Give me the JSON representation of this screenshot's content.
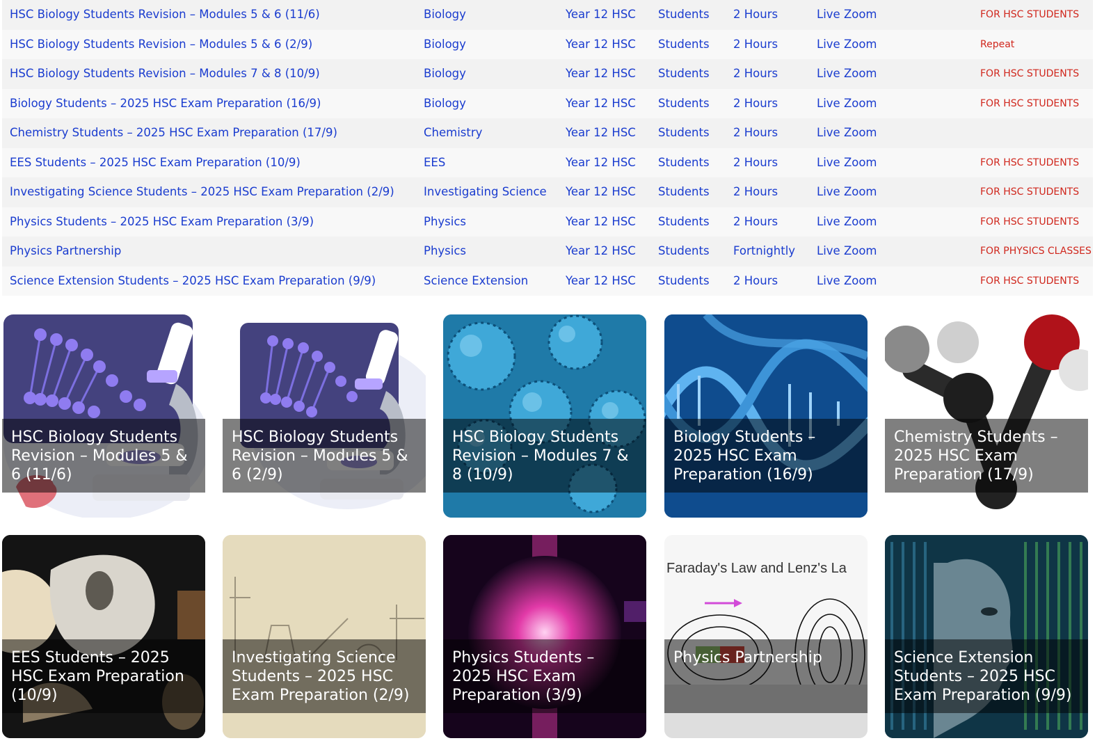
{
  "rows": [
    {
      "title": "HSC Biology Students Revision – Modules 5 & 6 (11/6)",
      "subject": "Biology",
      "year": "Year 12 HSC",
      "audience": "Students",
      "duration": "2 Hours",
      "mode": "Live Zoom",
      "tag": "FOR HSC STUDENTS"
    },
    {
      "title": "HSC Biology Students Revision – Modules 5 & 6 (2/9)",
      "subject": "Biology",
      "year": "Year 12 HSC",
      "audience": "Students",
      "duration": "2 Hours",
      "mode": "Live Zoom",
      "tag": "Repeat"
    },
    {
      "title": "HSC Biology Students Revision – Modules 7 & 8 (10/9)",
      "subject": "Biology",
      "year": "Year 12 HSC",
      "audience": "Students",
      "duration": "2 Hours",
      "mode": "Live Zoom",
      "tag": "FOR HSC STUDENTS"
    },
    {
      "title": "Biology Students – 2025 HSC Exam Preparation (16/9)",
      "subject": "Biology",
      "year": "Year 12 HSC",
      "audience": "Students",
      "duration": "2 Hours",
      "mode": "Live Zoom",
      "tag": "FOR HSC STUDENTS"
    },
    {
      "title": "Chemistry Students – 2025 HSC Exam Preparation (17/9)",
      "subject": "Chemistry",
      "year": "Year 12 HSC",
      "audience": "Students",
      "duration": "2 Hours",
      "mode": "Live Zoom",
      "tag": ""
    },
    {
      "title": "EES Students – 2025 HSC Exam Preparation (10/9)",
      "subject": "EES",
      "year": "Year 12 HSC",
      "audience": "Students",
      "duration": "2 Hours",
      "mode": "Live Zoom",
      "tag": "FOR HSC STUDENTS"
    },
    {
      "title": "Investigating Science Students – 2025 HSC Exam Preparation (2/9)",
      "subject": "Investigating Science",
      "year": "Year 12 HSC",
      "audience": "Students",
      "duration": "2 Hours",
      "mode": "Live Zoom",
      "tag": "FOR HSC STUDENTS"
    },
    {
      "title": "Physics Students – 2025 HSC Exam Preparation (3/9)",
      "subject": "Physics",
      "year": "Year 12 HSC",
      "audience": "Students",
      "duration": "2 Hours",
      "mode": "Live Zoom",
      "tag": "FOR HSC STUDENTS"
    },
    {
      "title": "Physics Partnership",
      "subject": "Physics",
      "year": "Year 12 HSC",
      "audience": "Students",
      "duration": "Fortnightly",
      "mode": "Live Zoom",
      "tag": "FOR PHYSICS CLASSES"
    },
    {
      "title": "Science Extension Students – 2025 HSC Exam Preparation (9/9)",
      "subject": "Science Extension",
      "year": "Year 12 HSC",
      "audience": "Students",
      "duration": "2 Hours",
      "mode": "Live Zoom",
      "tag": "FOR HSC STUDENTS"
    }
  ],
  "tiles": [
    {
      "caption": "HSC Biology Students Revision – Modules 5 & 6 (11/6)",
      "image": "dna-microscope-illustration"
    },
    {
      "caption": "HSC Biology Students Revision – Modules 5 & 6 (2/9)",
      "image": "dna-microscope-illustration"
    },
    {
      "caption": "HSC Biology Students Revision – Modules 7 & 8 (10/9)",
      "image": "virus-particles-photo"
    },
    {
      "caption": "Biology Students – 2025 HSC Exam Preparation (16/9)",
      "image": "dna-helix-photo"
    },
    {
      "caption": "Chemistry Students – 2025 HSC Exam Preparation (17/9)",
      "image": "molecule-model-photo"
    },
    {
      "caption": "EES Students – 2025 HSC Exam Preparation (10/9)",
      "image": "fossils-photo"
    },
    {
      "caption": "Investigating Science Students – 2025 HSC Exam Preparation (2/9)",
      "image": "lab-apparatus-sketch"
    },
    {
      "caption": "Physics Students – 2025 HSC Exam Preparation (3/9)",
      "image": "plasma-light-photo"
    },
    {
      "caption": "Physics Partnership",
      "image": "magnetic-field-diagram",
      "image_text": "Faraday's Law and Lenz's La"
    },
    {
      "caption": "Science Extension Students – 2025 HSC Exam Preparation (9/9)",
      "image": "binary-code-face-photo"
    }
  ],
  "colors": {
    "link": "#1a3ccf",
    "tag": "#d0271d",
    "row_odd": "#f2f2f2",
    "row_even": "#f8f8f8"
  }
}
